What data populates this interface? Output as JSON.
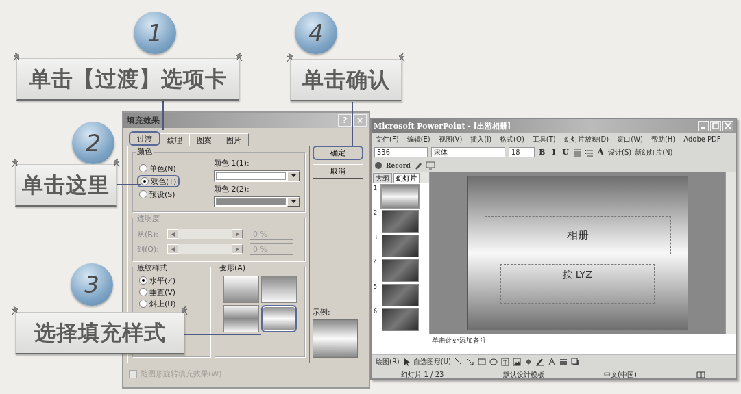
{
  "callouts": [
    {
      "step": "1",
      "text": "单击【过渡】选项卡"
    },
    {
      "step": "4",
      "text": "单击确认"
    },
    {
      "step": "2",
      "text": "单击这里"
    },
    {
      "step": "3",
      "text": "选择填充样式"
    }
  ],
  "dialog": {
    "title": "填充效果",
    "title_buttons": [
      "?",
      "×"
    ],
    "tabs": [
      {
        "label": "过渡",
        "selected": true,
        "highlighted": true
      },
      {
        "label": "纹理",
        "selected": false,
        "highlighted": false
      },
      {
        "label": "图案",
        "selected": false,
        "highlighted": false
      },
      {
        "label": "图片",
        "selected": false,
        "highlighted": false
      }
    ],
    "color_group": {
      "title": "颜色",
      "options": [
        {
          "label": "单色(N)",
          "selected": false,
          "highlighted": false
        },
        {
          "label": "双色(T)",
          "selected": true,
          "highlighted": true
        },
        {
          "label": "预设(S)",
          "selected": false,
          "highlighted": false
        }
      ],
      "colors": [
        {
          "label": "颜色 1(1):",
          "color": "#ffffff"
        },
        {
          "label": "颜色 2(2):",
          "color": "#8c8c8c"
        }
      ]
    },
    "transparency": {
      "title": "透明度",
      "disabled": true,
      "rows": [
        {
          "label": "从(R):",
          "value": "0 %"
        },
        {
          "label": "到(O):",
          "value": "0 %"
        }
      ]
    },
    "shading_styles": {
      "title": "底纹样式",
      "options": [
        {
          "label": "水平(Z)",
          "selected": true
        },
        {
          "label": "垂直(V)",
          "selected": false
        },
        {
          "label": "斜上(U)",
          "selected": false
        }
      ]
    },
    "variants": {
      "title": "变形(A)",
      "items": [
        {
          "kind": "light-top",
          "selected": false,
          "highlighted": false
        },
        {
          "kind": "dark-top",
          "selected": false,
          "highlighted": false
        },
        {
          "kind": "dark-band",
          "selected": false,
          "highlighted": false
        },
        {
          "kind": "light-band",
          "selected": true,
          "highlighted": true
        }
      ]
    },
    "sample_label": "示例:",
    "rotate_checkbox": {
      "label": "随图形旋转填充效果(W)",
      "checked": false,
      "disabled": true
    },
    "buttons": [
      {
        "label": "确定",
        "highlighted": true
      },
      {
        "label": "取消",
        "highlighted": false
      }
    ]
  },
  "powerpoint": {
    "title": "Microsoft PowerPoint - [出游相册]",
    "menu": [
      "文件(F)",
      "编辑(E)",
      "视图(V)",
      "插入(I)",
      "格式(O)",
      "工具(T)",
      "幻灯片放映(D)",
      "窗口(W)",
      "帮助(H)",
      "Adobe PDF"
    ],
    "formatting": {
      "style_box": "536",
      "font": "宋体",
      "size": "18",
      "format_buttons": [
        "B",
        "I",
        "U"
      ],
      "grow_font": "A",
      "design": "设计(S)",
      "new_slide": "新幻灯片(N)"
    },
    "record": "Record",
    "panel_tabs": [
      {
        "label": "大纲",
        "selected": false
      },
      {
        "label": "幻灯片",
        "selected": true
      }
    ],
    "thumbnails": [
      {
        "number": "1",
        "kind": "title",
        "selected": true
      },
      {
        "number": "2",
        "kind": "photo",
        "selected": false
      },
      {
        "number": "3",
        "kind": "photo",
        "selected": false
      },
      {
        "number": "4",
        "kind": "photo",
        "selected": false
      },
      {
        "number": "5",
        "kind": "photo",
        "selected": false
      },
      {
        "number": "6",
        "kind": "photo",
        "selected": false
      }
    ],
    "slide": {
      "title": "相册",
      "subtitle": "按 LYZ"
    },
    "notes_placeholder": "单击此处添加备注",
    "drawing_toolbar": {
      "draw": "绘图(R)",
      "autoshapes": "自选图形(U)"
    },
    "status": [
      "幻灯片 1 / 23",
      "默认设计模板",
      "中文(中国)"
    ]
  }
}
